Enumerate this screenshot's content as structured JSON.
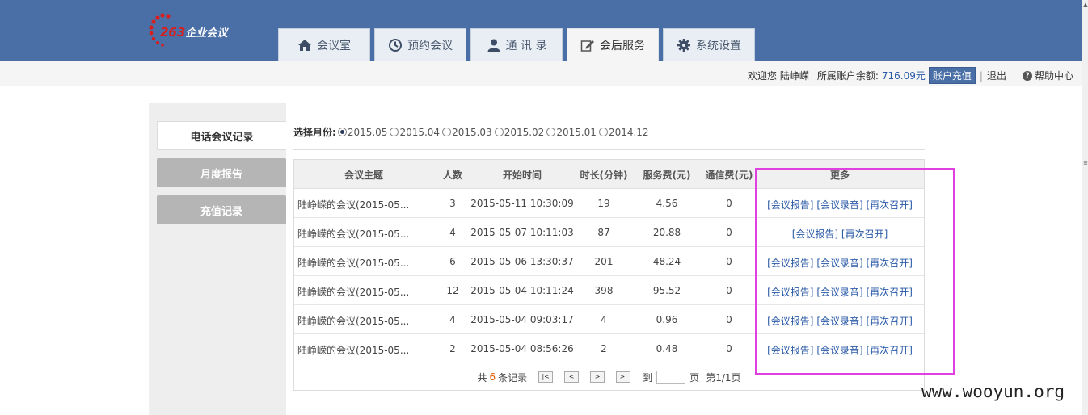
{
  "header": {
    "logo": {
      "number": "263",
      "text": "企业会议"
    },
    "tabs": [
      {
        "label": "会议室",
        "icon": "home-icon"
      },
      {
        "label": "预约会议",
        "icon": "clock-icon"
      },
      {
        "label": "通 讯 录",
        "icon": "user-icon"
      },
      {
        "label": "会后服务",
        "icon": "edit-icon",
        "active": true
      },
      {
        "label": "系统设置",
        "icon": "gear-icon"
      }
    ]
  },
  "welcome": {
    "greeting": "欢迎您 陆峥嵘",
    "balance_label": "所属账户余额:",
    "balance_value": "716.09元",
    "recharge": "账户充值",
    "separator": "|",
    "logout": "退出",
    "help": "帮助中心"
  },
  "sidebar": {
    "items": [
      {
        "label": "电话会议记录",
        "active": true
      },
      {
        "label": "月度报告"
      },
      {
        "label": "充值记录"
      }
    ]
  },
  "month_selector": {
    "label": "选择月份:",
    "options": [
      "2015.05",
      "2015.04",
      "2015.03",
      "2015.02",
      "2015.01",
      "2014.12"
    ],
    "selected": "2015.05"
  },
  "table": {
    "headers": [
      "会议主题",
      "人数",
      "开始时间",
      "时长(分钟)",
      "服务费(元)",
      "通信费(元)",
      "更多"
    ],
    "rows": [
      {
        "topic": "陆峥嵘的会议(2015-05...",
        "people": "3",
        "start": "2015-05-11 10:30:09",
        "duration": "19",
        "service_fee": "4.56",
        "comm_fee": "0",
        "links": [
          "[会议报告]",
          "[会议录音]",
          "[再次召开]"
        ]
      },
      {
        "topic": "陆峥嵘的会议(2015-05...",
        "people": "4",
        "start": "2015-05-07 10:11:03",
        "duration": "87",
        "service_fee": "20.88",
        "comm_fee": "0",
        "links": [
          "[会议报告]",
          "[再次召开]"
        ]
      },
      {
        "topic": "陆峥嵘的会议(2015-05...",
        "people": "6",
        "start": "2015-05-06 13:30:37",
        "duration": "201",
        "service_fee": "48.24",
        "comm_fee": "0",
        "links": [
          "[会议报告]",
          "[会议录音]",
          "[再次召开]"
        ]
      },
      {
        "topic": "陆峥嵘的会议(2015-05...",
        "people": "12",
        "start": "2015-05-04 10:11:24",
        "duration": "398",
        "service_fee": "95.52",
        "comm_fee": "0",
        "links": [
          "[会议报告]",
          "[会议录音]",
          "[再次召开]"
        ]
      },
      {
        "topic": "陆峥嵘的会议(2015-05...",
        "people": "4",
        "start": "2015-05-04 09:03:17",
        "duration": "4",
        "service_fee": "0.96",
        "comm_fee": "0",
        "links": [
          "[会议报告]",
          "[会议录音]",
          "[再次召开]"
        ]
      },
      {
        "topic": "陆峥嵘的会议(2015-05...",
        "people": "2",
        "start": "2015-05-04 08:56:26",
        "duration": "2",
        "service_fee": "0.48",
        "comm_fee": "0",
        "links": [
          "[会议报告]",
          "[会议录音]",
          "[再次召开]"
        ]
      }
    ]
  },
  "pager": {
    "prefix": "共",
    "count": "6",
    "suffix": "条记录",
    "first": "|<",
    "prev": "<",
    "next": ">",
    "last": ">|",
    "goto_label": "到",
    "page_unit": "页",
    "page_info": "第1/1页"
  },
  "watermark": "www.wooyun.org",
  "colors": {
    "header_bg": "#4a6fa6",
    "link": "#2a5aa8",
    "highlight": "#e040e0",
    "count": "#e05a00"
  }
}
